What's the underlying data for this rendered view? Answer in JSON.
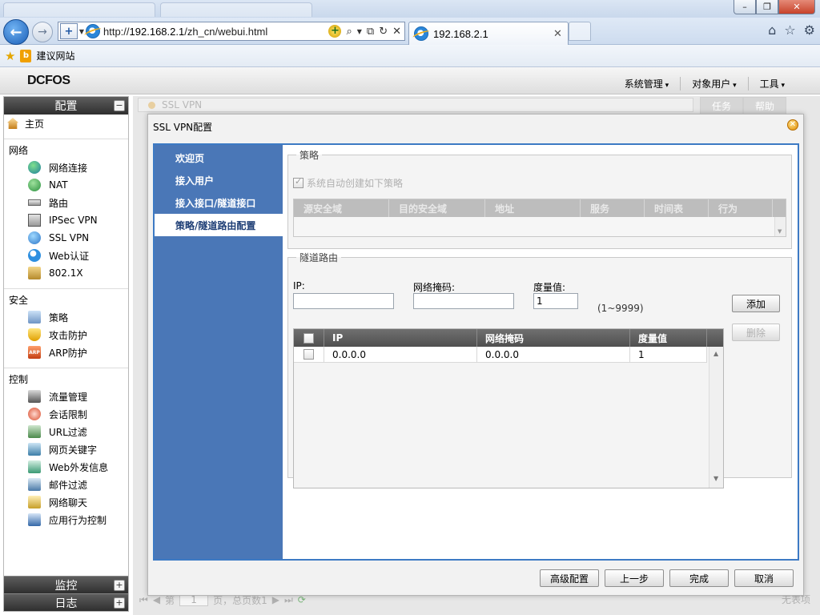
{
  "browser": {
    "url_prefix": "http://",
    "url_host": "192.168.2.1",
    "url_path": "/zh_cn/webui.html",
    "tab_title": "192.168.2.1",
    "favorites": {
      "suggested_sites": "建议网站"
    },
    "icons": [
      "back-icon",
      "forward-icon",
      "compat-view-icon",
      "ie-icon",
      "addon-icon",
      "search-icon",
      "compat-icon",
      "refresh-icon",
      "stop-icon",
      "home-icon",
      "favorites-star-icon",
      "settings-gear-icon"
    ]
  },
  "app": {
    "logo": "DCFOS",
    "menu": [
      "系统管理",
      "对象用户",
      "工具"
    ]
  },
  "sidebar": {
    "config_title": "配置",
    "home": "主页",
    "sections": [
      {
        "title": "网络",
        "items": [
          {
            "label": "网络连接",
            "icon": "globe-icon"
          },
          {
            "label": "NAT",
            "icon": "nat-icon"
          },
          {
            "label": "路由",
            "icon": "router-icon"
          },
          {
            "label": "IPSec VPN",
            "icon": "ipsec-icon"
          },
          {
            "label": "SSL VPN",
            "icon": "ssl-vpn-icon"
          },
          {
            "label": "Web认证",
            "icon": "web-auth-icon"
          },
          {
            "label": "802.1X",
            "icon": "8021x-icon"
          }
        ]
      },
      {
        "title": "安全",
        "items": [
          {
            "label": "策略",
            "icon": "policy-icon"
          },
          {
            "label": "攻击防护",
            "icon": "shield-icon"
          },
          {
            "label": "ARP防护",
            "icon": "arp-icon"
          }
        ]
      },
      {
        "title": "控制",
        "items": [
          {
            "label": "流量管理",
            "icon": "traffic-icon"
          },
          {
            "label": "会话限制",
            "icon": "session-icon"
          },
          {
            "label": "URL过滤",
            "icon": "url-filter-icon"
          },
          {
            "label": "网页关键字",
            "icon": "keyword-icon"
          },
          {
            "label": "Web外发信息",
            "icon": "web-outbound-icon"
          },
          {
            "label": "邮件过滤",
            "icon": "mail-filter-icon"
          },
          {
            "label": "网络聊天",
            "icon": "chat-icon"
          },
          {
            "label": "应用行为控制",
            "icon": "app-control-icon"
          }
        ]
      }
    ],
    "monitor_title": "监控",
    "log_title": "日志"
  },
  "workspace": {
    "bg_tab": "SSL VPN",
    "right_tabs": [
      "任务",
      "帮助"
    ],
    "pager": {
      "page_label": "第",
      "page_value": "1",
      "page_suffix": "页，总页数1"
    },
    "no_items": "无表项"
  },
  "dialog": {
    "title": "SSL VPN配置",
    "steps": [
      {
        "label": "欢迎页",
        "active": false
      },
      {
        "label": "接入用户",
        "active": false
      },
      {
        "label": "接入接口/隧道接口",
        "active": false
      },
      {
        "label": "策略/隧道路由配置",
        "active": true
      }
    ],
    "policy": {
      "legend": "策略",
      "auto_create_label": "系统自动创建如下策略",
      "auto_create_checked": true,
      "columns": [
        "源安全域",
        "目的安全域",
        "地址",
        "服务",
        "时间表",
        "行为"
      ]
    },
    "route": {
      "legend": "隧道路由",
      "ip_label": "IP:",
      "ip_value": "",
      "mask_label": "网络掩码:",
      "mask_value": "",
      "metric_label": "度量值:",
      "metric_value": "1",
      "metric_range": "(1~9999)",
      "add_button": "添加",
      "delete_button": "删除",
      "columns": [
        "IP",
        "网络掩码",
        "度量值"
      ],
      "rows": [
        {
          "ip": "0.0.0.0",
          "mask": "0.0.0.0",
          "metric": "1"
        }
      ]
    },
    "footer": {
      "advanced": "高级配置",
      "prev": "上一步",
      "finish": "完成",
      "cancel": "取消"
    }
  }
}
